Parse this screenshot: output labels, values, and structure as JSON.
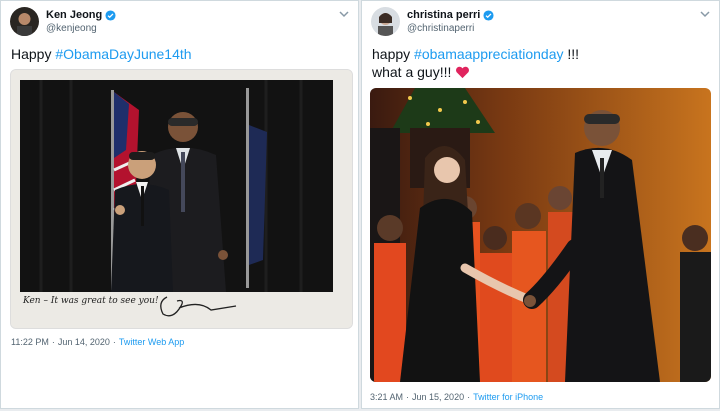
{
  "left_tweet": {
    "author_name": "Ken Jeong",
    "author_handle": "@kenjeong",
    "text_prefix": "Happy ",
    "hashtag": "#ObamaDayJune14th",
    "photo_inscription": "Ken – It was great to see you!",
    "time": "11:22 PM",
    "date": "Jun 14, 2020",
    "source": "Twitter Web App"
  },
  "right_tweet": {
    "author_name": "christina perri",
    "author_handle": "@christinaperri",
    "text_prefix": "happy ",
    "hashtag": "#obamaappreciationday",
    "text_suffix": " !!!",
    "line2": "what a guy!!! ",
    "time": "3:21 AM",
    "date": "Jun 15, 2020",
    "source": "Twitter for iPhone"
  },
  "colors": {
    "accent": "#1d9bf0",
    "heart": "#e0245e"
  },
  "icons": [
    "verified-icon",
    "chevron-down-icon",
    "heart-icon"
  ]
}
